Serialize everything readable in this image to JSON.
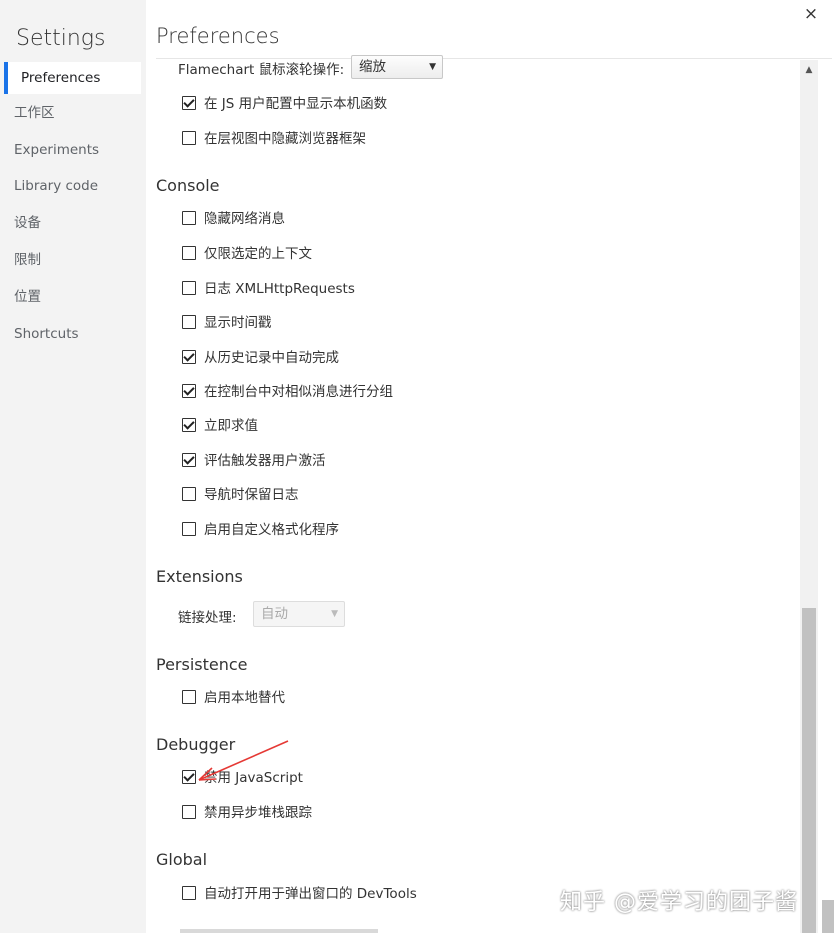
{
  "sidebar": {
    "title": "Settings",
    "items": [
      {
        "label": "Preferences"
      },
      {
        "label": "工作区"
      },
      {
        "label": "Experiments"
      },
      {
        "label": "Library code"
      },
      {
        "label": "设备"
      },
      {
        "label": "限制"
      },
      {
        "label": "位置"
      },
      {
        "label": "Shortcuts"
      }
    ]
  },
  "main": {
    "title": "Preferences",
    "close": "×",
    "flamechart": {
      "label": "Flamechart 鼠标滚轮操作:",
      "value": "缩放"
    },
    "top_items": [
      {
        "label": "在 JS 用户配置中显示本机函数",
        "checked": true
      },
      {
        "label": "在层视图中隐藏浏览器框架",
        "checked": false
      }
    ],
    "console": {
      "heading": "Console",
      "items": [
        {
          "label": "隐藏网络消息",
          "checked": false
        },
        {
          "label": "仅限选定的上下文",
          "checked": false
        },
        {
          "label": "日志 XMLHttpRequests",
          "checked": false
        },
        {
          "label": "显示时间戳",
          "checked": false
        },
        {
          "label": "从历史记录中自动完成",
          "checked": true
        },
        {
          "label": "在控制台中对相似消息进行分组",
          "checked": true
        },
        {
          "label": "立即求值",
          "checked": true
        },
        {
          "label": "评估触发器用户激活",
          "checked": true
        },
        {
          "label": "导航时保留日志",
          "checked": false
        },
        {
          "label": "启用自定义格式化程序",
          "checked": false
        }
      ]
    },
    "extensions": {
      "heading": "Extensions",
      "link_label": "链接处理:",
      "link_value": "自动"
    },
    "persistence": {
      "heading": "Persistence",
      "items": [
        {
          "label": "启用本地替代",
          "checked": false
        }
      ]
    },
    "debugger": {
      "heading": "Debugger",
      "items": [
        {
          "label": "禁用 JavaScript",
          "checked": true
        },
        {
          "label": "禁用异步堆栈跟踪",
          "checked": false
        }
      ]
    },
    "global": {
      "heading": "Global",
      "items": [
        {
          "label": "自动打开用于弹出窗口的 DevTools",
          "checked": false
        }
      ]
    }
  },
  "watermark": "知乎 @爱学习的团子酱",
  "colors": {
    "accent": "#1a73e8",
    "annotation": "#e53935"
  }
}
